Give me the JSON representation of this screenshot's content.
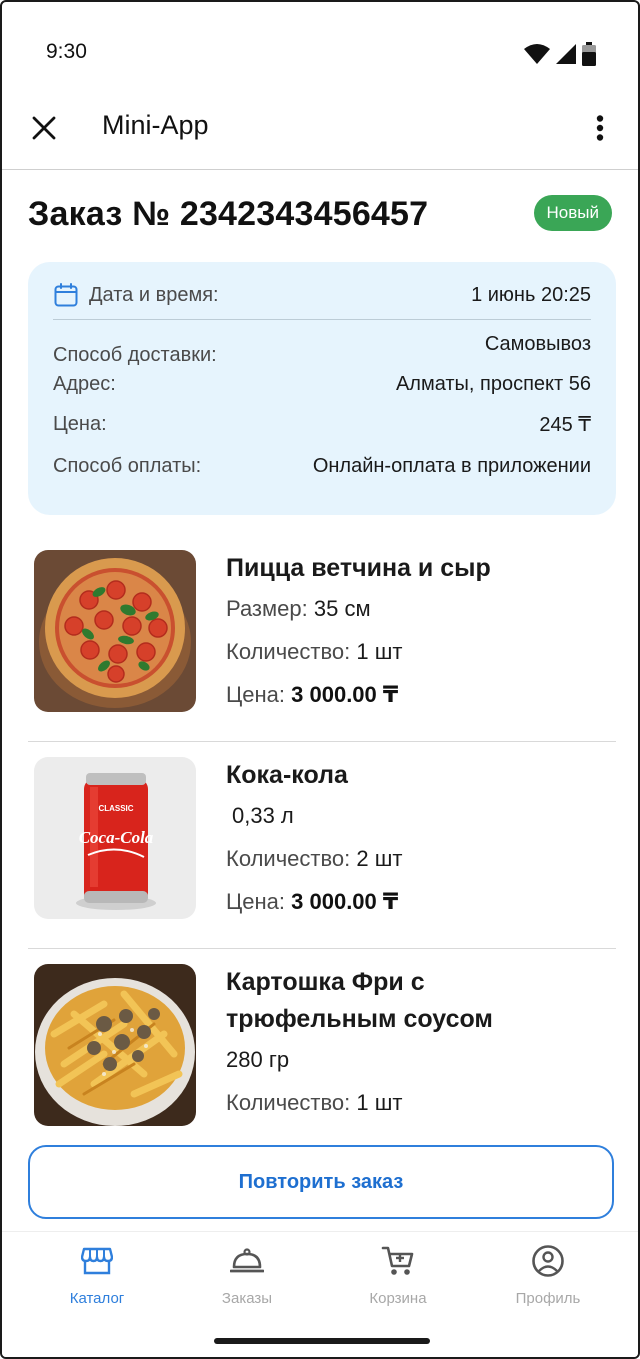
{
  "status_bar": {
    "time": "9:30"
  },
  "app_bar": {
    "title": "Mini-App"
  },
  "order": {
    "title": "Заказ № 2342343456457",
    "status": "Новый",
    "status_color": "#3aa656"
  },
  "info": {
    "datetime_label": "Дата и время:",
    "datetime_value": "1 июнь 20:25",
    "delivery_label": "Способ доставки:",
    "delivery_value": "Самовывоз",
    "address_label": "Адрес:",
    "address_value": "Алматы, проспект 56",
    "price_label": "Цена:",
    "price_value": "245 ₸",
    "payment_label": "Способ оплаты:",
    "payment_value": "Онлайн-оплата в приложении"
  },
  "products": [
    {
      "name": "Пицца ветчина и сыр",
      "size_label": "Размер:",
      "size_value": "35 см",
      "qty_label": "Количество:",
      "qty_value": "1 шт",
      "price_label": "Цена:",
      "price_value": "3 000.00 ₸"
    },
    {
      "name": "Кока-кола",
      "volume": "0,33 л",
      "qty_label": "Количество:",
      "qty_value": "2 шт",
      "price_label": "Цена:",
      "price_value": "3 000.00 ₸",
      "can_text": "CLASSIC",
      "can_brand": "Coca-Cola"
    },
    {
      "name_line1": "Картошка Фри с",
      "name_line2": "трюфельным соусом",
      "weight": "280 гр",
      "qty_label": "Количество:",
      "qty_value": "1 шт"
    }
  ],
  "repeat_button": "Повторить заказ",
  "nav": {
    "catalog": "Каталог",
    "orders": "Заказы",
    "cart": "Корзина",
    "profile": "Профиль",
    "active_color": "#2f7fdc"
  },
  "icons": {
    "close": "close-icon",
    "more": "more-vertical-icon",
    "calendar": "calendar-icon",
    "catalog": "store-icon",
    "orders": "cloche-icon",
    "cart": "cart-icon",
    "profile": "account-circle-icon"
  }
}
